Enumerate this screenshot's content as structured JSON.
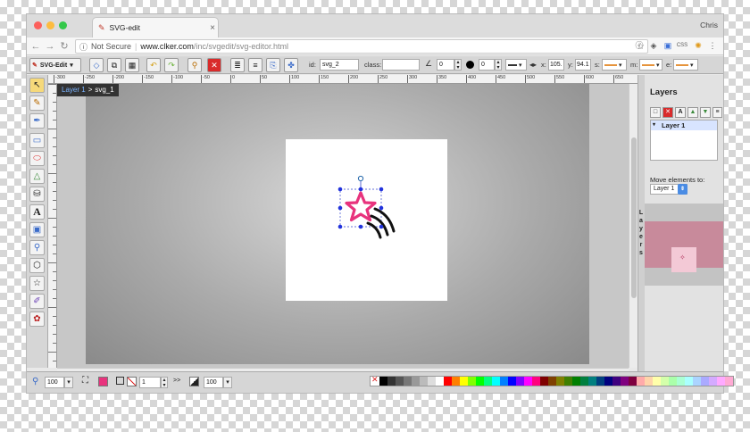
{
  "browser": {
    "tab_title": "SVG-edit",
    "tab_close": "×",
    "user": "Chris",
    "security_label": "Not Secure",
    "url_host": "www.clker.com",
    "url_path": "/inc/svgedit/svg-editor.html",
    "ext_css": "CSS"
  },
  "toolbar": {
    "logo_label": "SVG-Edit",
    "id_label": "id:",
    "id_value": "svg_2",
    "class_label": "class:",
    "class_value": "",
    "angle_value": "0",
    "blur_value": "0",
    "x_label": "x:",
    "x_value": "105.",
    "y_label": "y:",
    "y_value": "94.1",
    "s_label": "s:",
    "m_label": "m:",
    "e_label": "e:"
  },
  "canvas": {
    "crumb_layer": "Layer 1",
    "crumb_sep": ">",
    "crumb_elem": "svg_1",
    "star_color": "#e8337d",
    "selection_color": "#2222dd"
  },
  "rulers": {
    "h_ticks": [
      "-300",
      "-250",
      "-200",
      "-150",
      "-100",
      "-50",
      "0",
      "50",
      "100",
      "150",
      "200",
      "250",
      "300",
      "350",
      "400",
      "450",
      "500",
      "550",
      "600",
      "650"
    ]
  },
  "layers_panel": {
    "title": "Layers",
    "layer_name": "Layer 1",
    "move_label": "Move elements to:",
    "move_value": "Layer 1",
    "vertical_label": [
      "L",
      "a",
      "y",
      "e",
      "r",
      "s"
    ]
  },
  "bottom": {
    "zoom_value": "100",
    "stroke_width": "1",
    "opacity_value": "100",
    "fill_color": "#e8337d",
    "palette": [
      "#000000",
      "#333333",
      "#555555",
      "#777777",
      "#999999",
      "#bbbbbb",
      "#dddddd",
      "#ffffff",
      "#ff0000",
      "#ff7f00",
      "#ffff00",
      "#7fff00",
      "#00ff00",
      "#00ff7f",
      "#00ffff",
      "#007fff",
      "#0000ff",
      "#7f00ff",
      "#ff00ff",
      "#ff007f",
      "#7f0000",
      "#7f3f00",
      "#7f7f00",
      "#3f7f00",
      "#007f00",
      "#007f3f",
      "#007f7f",
      "#003f7f",
      "#00007f",
      "#3f007f",
      "#7f007f",
      "#7f003f",
      "#ffaaaa",
      "#ffd4aa",
      "#ffffaa",
      "#d4ffaa",
      "#aaffaa",
      "#aaffd4",
      "#aaffff",
      "#aad4ff",
      "#aaaaff",
      "#d4aaff",
      "#ffaaff",
      "#ffaad4"
    ]
  }
}
